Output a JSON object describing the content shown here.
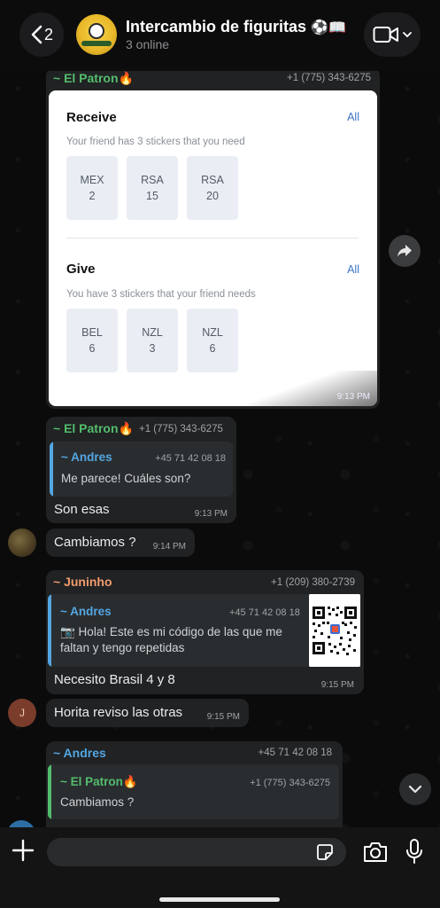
{
  "header": {
    "back_count": "2",
    "title": "Intercambio de figuritas",
    "title_emoji": "⚽📖",
    "subtitle": "3 online"
  },
  "messages": [
    {
      "sender": "~ El Patron🔥",
      "phone": "+1 (775) 343-6275",
      "card": {
        "receive": {
          "title": "Receive",
          "all": "All",
          "desc": "Your friend has 3 stickers that you need",
          "stickers": [
            {
              "team": "MEX",
              "num": "2"
            },
            {
              "team": "RSA",
              "num": "15"
            },
            {
              "team": "RSA",
              "num": "20"
            }
          ]
        },
        "give": {
          "title": "Give",
          "all": "All",
          "desc": "You have 3 stickers that your friend needs",
          "stickers": [
            {
              "team": "BEL",
              "num": "6"
            },
            {
              "team": "NZL",
              "num": "3"
            },
            {
              "team": "NZL",
              "num": "6"
            }
          ]
        }
      },
      "time": "9:13 PM"
    },
    {
      "sender": "~ El Patron🔥",
      "phone": "+1 (775) 343-6275",
      "quote": {
        "name": "~ Andres",
        "phone": "+45 71 42 08 18",
        "text": "Me parece! Cuáles son?"
      },
      "text": "Son esas",
      "time": "9:13 PM"
    },
    {
      "text": "Cambiamos ?",
      "time": "9:14 PM"
    },
    {
      "sender": "~ Juninho",
      "phone": "+1 (209) 380-2739",
      "quote": {
        "name": "~ Andres",
        "phone": "+45 71 42 08 18",
        "text_line1": "📷 Hola! Este es mi código de las que me",
        "text_line2": "faltan y tengo repetidas"
      },
      "text": "Necesito Brasil 4 y 8",
      "time": "9:15 PM"
    },
    {
      "avatar_letter": "J",
      "text": "Horita reviso las otras",
      "time": "9:15 PM"
    },
    {
      "sender": "~ Andres",
      "phone": "+45 71 42 08 18",
      "quote": {
        "name": "~ El Patron🔥",
        "phone": "+1 (775) 343-6275",
        "text": "Cambiamos ?"
      }
    }
  ],
  "input": {
    "placeholder": ""
  },
  "icons": [
    "back-chevron-icon",
    "video-camera-icon",
    "chevron-down-icon",
    "forward-icon",
    "plus-icon",
    "sticker-icon",
    "camera-icon",
    "microphone-icon"
  ],
  "colors": {
    "green_sender": "#53bd6e",
    "orange_sender": "#f39a6d",
    "blue_sender": "#53a6e2",
    "link": "#3b72c9"
  }
}
